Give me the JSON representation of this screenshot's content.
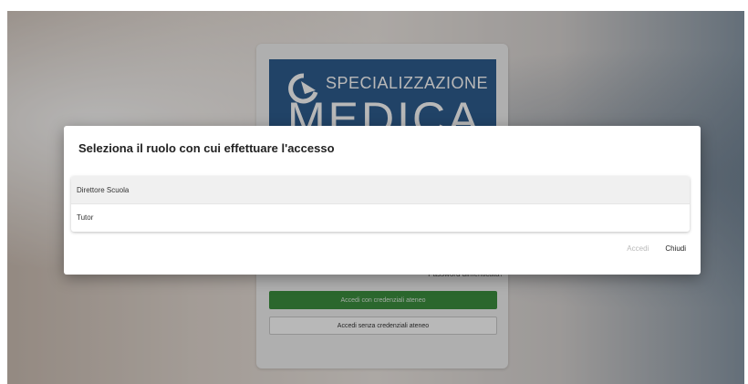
{
  "background": {
    "logo": {
      "top_text": "SPECIALIZZAZIONE",
      "big_text": "MEDICA",
      "icon": "refresh-arrow-icon",
      "color": "#2f5d8f"
    },
    "forgot_password": "Password dimenticata?",
    "login_with_credentials": "Accedi con credenziali ateneo",
    "login_without_credentials": "Accedi senza credenziali ateneo",
    "primary_color": "#3c8f3f"
  },
  "modal": {
    "title": "Seleziona il ruolo con cui effettuare l'accesso",
    "roles": [
      {
        "label": "Direttore Scuola",
        "selected": true
      },
      {
        "label": "Tutor",
        "selected": false
      }
    ],
    "accedi_label": "Accedi",
    "chiudi_label": "Chiudi"
  }
}
